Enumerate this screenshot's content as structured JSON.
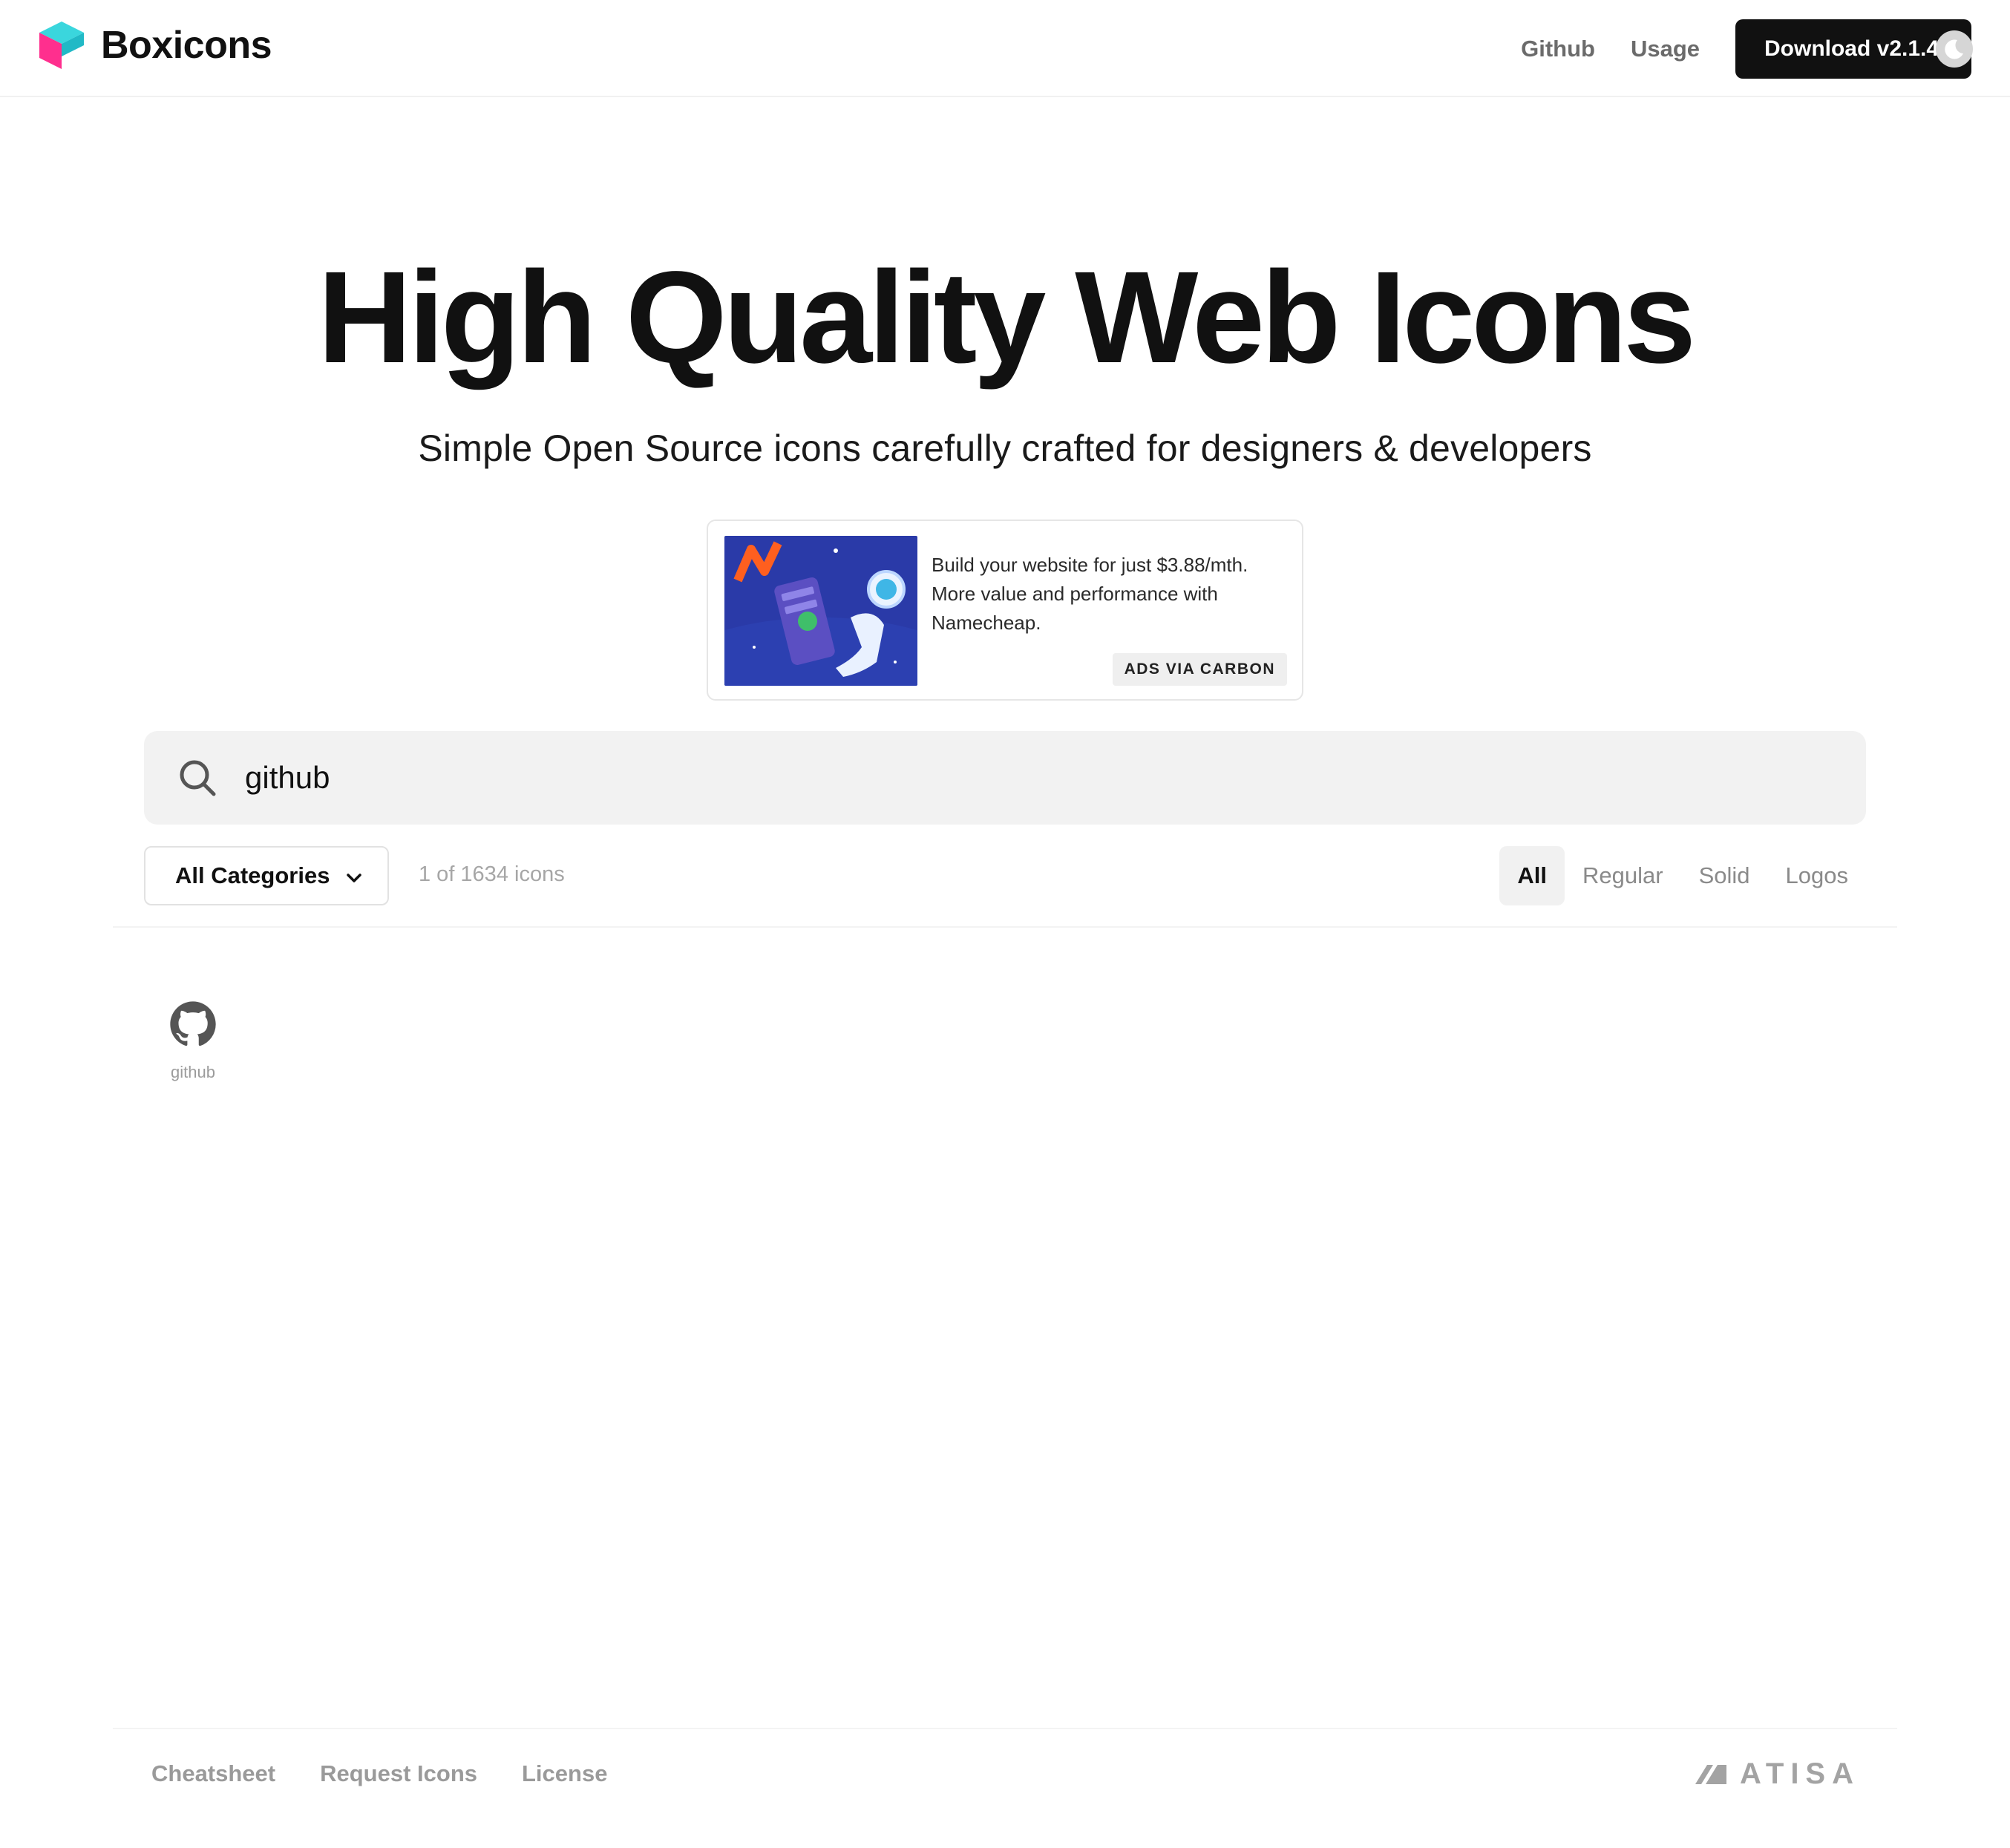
{
  "header": {
    "brand_name": "Boxicons",
    "nav": {
      "github": "Github",
      "usage": "Usage"
    },
    "download_label": "Download v2.1.4",
    "icons": {
      "logo": "boxicons-logo",
      "theme_toggle": "moon-icon"
    }
  },
  "hero": {
    "title": "High Quality Web Icons",
    "subtitle": "Simple Open Source icons carefully crafted for designers & developers"
  },
  "ad": {
    "text": "Build your website for just $3.88/mth. More value and performance with Namecheap.",
    "label": "ADS VIA CARBON"
  },
  "search": {
    "value": "github",
    "icon": "search-icon"
  },
  "filters": {
    "category": "All Categories",
    "count": "1 of 1634 icons",
    "tabs": [
      "All",
      "Regular",
      "Solid",
      "Logos"
    ],
    "active_tab": "All"
  },
  "results": [
    {
      "name": "github",
      "icon": "github-icon"
    }
  ],
  "footer": {
    "links": [
      "Cheatsheet",
      "Request Icons",
      "License"
    ],
    "brand": "ATISA"
  },
  "colors": {
    "primary": "#111111",
    "muted": "#8a8a8a",
    "search_bg": "#f2f2f2",
    "logo_cyan": "#3ad6dd",
    "logo_pink": "#ff2f8e"
  }
}
